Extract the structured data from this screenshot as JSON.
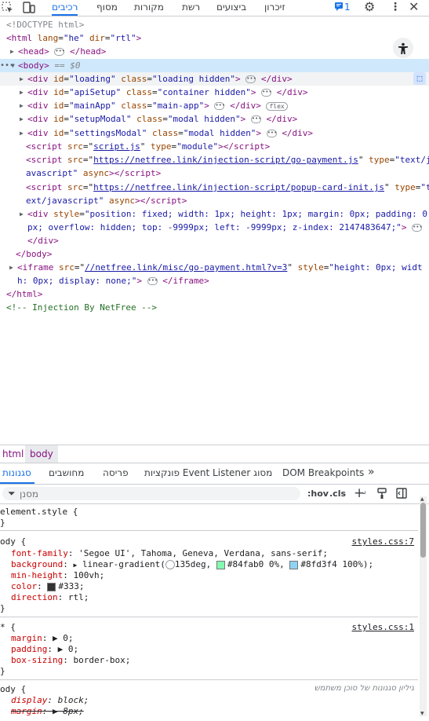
{
  "topbar": {
    "tabs": [
      "רכיבים",
      "מסוף",
      "מקורות",
      "רשת",
      "ביצועים",
      "זיכרון"
    ],
    "issues_count": "1"
  },
  "tree": {
    "doctype": "<!DOCTYPE html>",
    "html_open_tag": "html",
    "html_attrs": [
      {
        "name": "lang",
        "value": "\"he\""
      },
      {
        "name": "dir",
        "value": "\"rtl\""
      }
    ],
    "head_tag": "head",
    "body_tag": "body",
    "body_marker": "== $0",
    "divs": [
      {
        "id": "\"loading\"",
        "class": "\"loading hidden\"",
        "badge": ""
      },
      {
        "id": "\"apiSetup\"",
        "class": "\"container hidden\"",
        "badge": ""
      },
      {
        "id": "\"mainApp\"",
        "class": "\"main-app\"",
        "badge": "flex"
      },
      {
        "id": "\"setupModal\"",
        "class": "\"modal hidden\"",
        "badge": ""
      },
      {
        "id": "\"settingsModal\"",
        "class": "\"modal hidden\"",
        "badge": ""
      }
    ],
    "script1": {
      "src": "script.js",
      "type": "\"module\""
    },
    "script2": {
      "src": "https://netfree.link/injection-script/go-payment.js",
      "type_a": "\"text/j",
      "type_b": "avascript\"",
      "async": "async"
    },
    "script3": {
      "src": "https://netfree.link/injection-script/popup-card-init.js",
      "type_a": "\"t",
      "type_b": "ext/javascript\"",
      "async": "async"
    },
    "style_div_line1": "\"position: fixed; width: 1px; height: 1px; margin: 0px; padding: 0",
    "style_div_line2": "px; overflow: hidden; top: -9999px; left: -9999px; z-index: 2147483647;\"",
    "iframe_src": "//netfree.link/misc/go-payment.html?v=3",
    "iframe_style_a": "\"height: 0px; widt",
    "iframe_style_b": "h: 0px; display: none;\"",
    "comment": "<!-- Injection By NetFree -->"
  },
  "crumbs": [
    "html",
    "body"
  ],
  "bottom_tabs": [
    "סגנונות",
    "מחושבים",
    "פריסה",
    "פונקציות Event Listener מסוג",
    "DOM Breakpoints"
  ],
  "filter": {
    "placeholder": "מסנן",
    "hov": ":hov",
    "cls": ".cls"
  },
  "styles": {
    "element_style": "element.style {",
    "rule1": {
      "selector": "ody {",
      "source": "styles.css:7",
      "props": [
        {
          "name": "font-family",
          "value": "'Segoe UI', Tahoma, Geneva, Verdana, sans-serif;"
        },
        {
          "name": "background",
          "value": "linear-gradient(  135deg,   #84fab0 0%,   #8fd3f4 100%);"
        },
        {
          "name": "min-height",
          "value": "100vh;"
        },
        {
          "name": "color",
          "value": "#333;"
        },
        {
          "name": "direction",
          "value": "rtl;"
        }
      ]
    },
    "rule2": {
      "selector": "* {",
      "source": "styles.css:1",
      "props": [
        {
          "name": "margin",
          "value": "▶ 0;"
        },
        {
          "name": "padding",
          "value": "▶ 0;"
        },
        {
          "name": "box-sizing",
          "value": "border-box;"
        }
      ]
    },
    "rule3": {
      "selector": "ody {",
      "note": "גיליון סגנונות של סוכן משתמש",
      "props": [
        {
          "name": "display",
          "value": "block;"
        },
        {
          "name": "margin",
          "value": "▶ 8px;"
        }
      ]
    },
    "colors": {
      "grad1": "#84fab0",
      "grad2": "#8fd3f4",
      "text": "#333333"
    }
  }
}
